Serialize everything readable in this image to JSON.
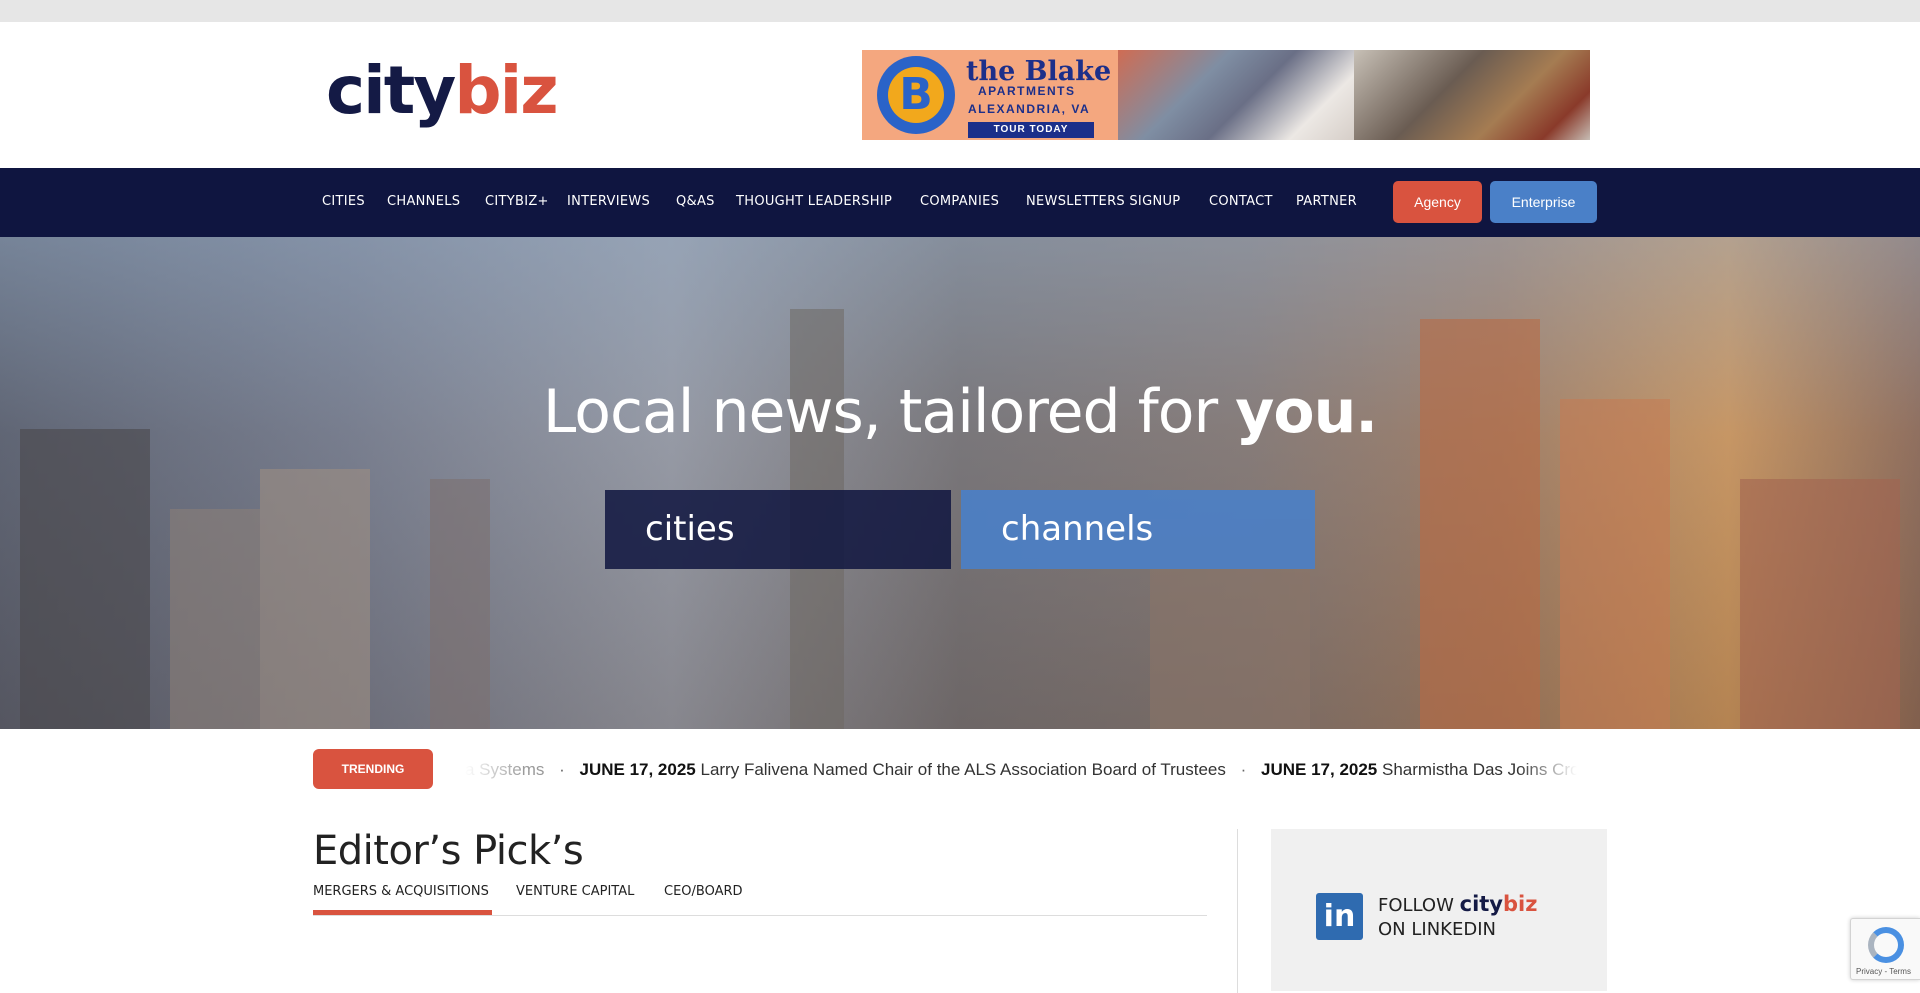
{
  "logo": {
    "part1": "city",
    "part2": "biz"
  },
  "ad": {
    "letter": "B",
    "brand": "the Blake",
    "line1": "APARTMENTS",
    "line2": "ALEXANDRIA, VA",
    "cta": "TOUR TODAY"
  },
  "nav": {
    "items": [
      "CITIES",
      "CHANNELS",
      "CITYBIZ+",
      "INTERVIEWS",
      "Q&AS",
      "THOUGHT LEADERSHIP",
      "COMPANIES",
      "NEWSLETTERS SIGNUP",
      "CONTACT",
      "PARTNER"
    ],
    "agency_label": "Agency",
    "enterprise_label": "Enterprise"
  },
  "hero": {
    "title_regular": "Local news, tailored for ",
    "title_bold": "you.",
    "cities_label": "cities",
    "channels_label": "channels"
  },
  "trending": {
    "badge": "TRENDING",
    "leading_fragment": "a Systems",
    "separator": "·",
    "items": [
      {
        "date": "JUNE 17, 2025",
        "headline": "Larry Falivena Named Chair of the ALS Association Board of Trustees"
      },
      {
        "date": "JUNE 17, 2025",
        "headline": "Sharmistha Das Joins Crowell & M"
      }
    ]
  },
  "editors_pick": {
    "title": "Editor’s Pick’s",
    "tabs": [
      "MERGERS & ACQUISITIONS",
      "VENTURE CAPITAL",
      "CEO/BOARD"
    ],
    "active_tab": "MERGERS & ACQUISITIONS"
  },
  "linkedin": {
    "icon_text": "in",
    "follow": "FOLLOW ",
    "brand1": "city",
    "brand2": "biz",
    "line2": "ON LINKEDIN"
  },
  "recaptcha": {
    "text": "Privacy - Terms"
  },
  "colors": {
    "navy": "#0f1540",
    "accent_red": "#d9533f",
    "accent_blue": "#4a80c8"
  }
}
